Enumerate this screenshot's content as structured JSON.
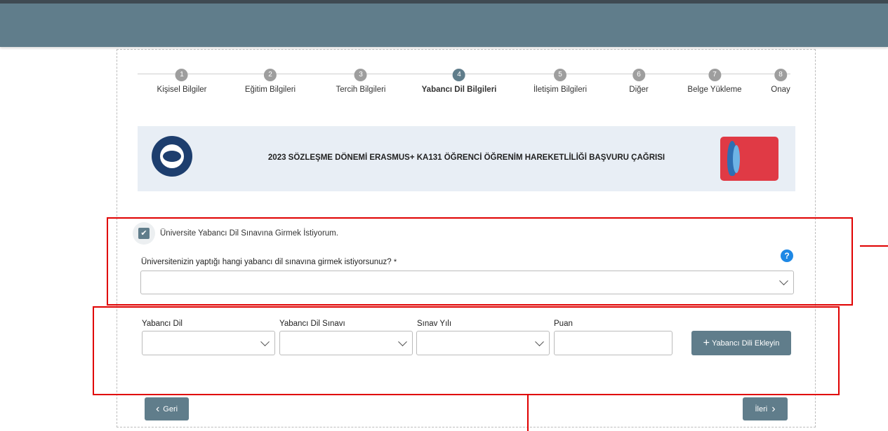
{
  "stepper": {
    "steps": [
      {
        "num": "1",
        "label": "Kişisel Bilgiler"
      },
      {
        "num": "2",
        "label": "Eğitim Bilgileri"
      },
      {
        "num": "3",
        "label": "Tercih Bilgileri"
      },
      {
        "num": "4",
        "label": "Yabancı Dil Bilgileri"
      },
      {
        "num": "5",
        "label": "İletişim Bilgileri"
      },
      {
        "num": "6",
        "label": "Diğer"
      },
      {
        "num": "7",
        "label": "Belge Yükleme"
      },
      {
        "num": "8",
        "label": "Onay"
      }
    ],
    "active_step": "4"
  },
  "banner": {
    "title": "2023 SÖZLEŞME DÖNEMİ ERASMUS+ KA131 ÖĞRENCİ ÖĞRENİM HAREKETLİLİĞİ BAŞVURU ÇAĞRISI"
  },
  "exam": {
    "checkbox_label": "Üniversite Yabancı Dil Sınavına Girmek İstiyorum.",
    "checkbox_checked": true,
    "question_label": "Üniversitenizin yaptığı hangi yabancı dil sınavına girmek istiyorsunuz?",
    "required_mark": "*",
    "help_glyph": "?",
    "select_value": ""
  },
  "language": {
    "lang_label": "Yabancı Dil",
    "exam_label": "Yabancı Dil Sınavı",
    "year_label": "Sınav Yılı",
    "score_label": "Puan",
    "lang_value": "",
    "exam_value": "",
    "year_value": "",
    "score_value": "",
    "add_button_plus": "+",
    "add_button_label": "Yabancı Dili Ekleyin"
  },
  "nav": {
    "back_icon": "‹",
    "back_label": "Geri",
    "next_label": "İleri",
    "next_icon": "›"
  },
  "colors": {
    "header": "#607d8b",
    "accent": "#607d8b",
    "highlight": "#e00000",
    "help": "#1e88e5"
  }
}
